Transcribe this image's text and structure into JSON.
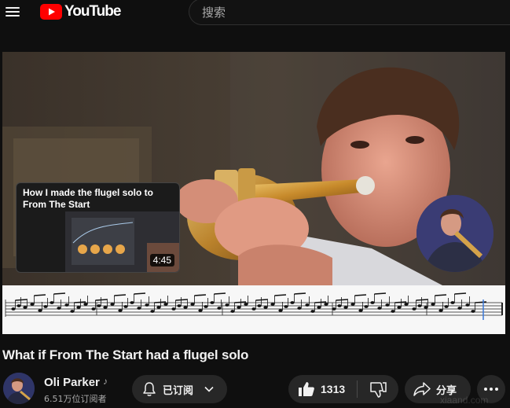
{
  "header": {
    "logo_text": "YouTube",
    "search_placeholder": "搜索"
  },
  "player": {
    "end_card": {
      "title": "How I made the flugel solo to From The Start",
      "duration": "4:45"
    }
  },
  "video": {
    "title": "What if From The Start had a flugel solo"
  },
  "channel": {
    "name": "Oli Parker",
    "badge_glyph": "♪",
    "subscribers": "6.51万位订阅者"
  },
  "actions": {
    "subscribe_label": "已订阅",
    "like_count": "1313",
    "share_label": "分享"
  },
  "colors": {
    "background": "#0f0f0f",
    "brand_red": "#ff0000",
    "pill": "#272727",
    "text": "#f1f1f1",
    "muted_text": "#aaaaaa"
  },
  "icons": [
    "menu-icon",
    "youtube-logo-icon",
    "bell-icon",
    "chevron-down-icon",
    "thumbs-up-icon",
    "thumbs-down-icon",
    "share-icon",
    "more-icon",
    "music-note-icon"
  ]
}
